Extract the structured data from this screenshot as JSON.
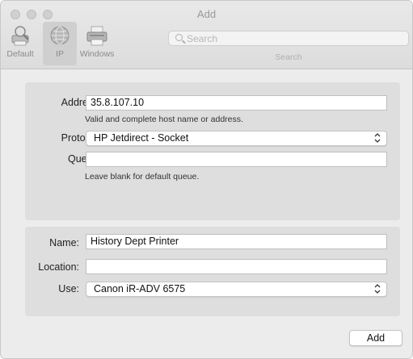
{
  "window": {
    "title": "Add"
  },
  "toolbar": {
    "default_label": "Default",
    "ip_label": "IP",
    "windows_label": "Windows",
    "search_label": "Search"
  },
  "search": {
    "placeholder": "Search"
  },
  "connection": {
    "address_label": "Address:",
    "address_value": "35.8.107.10",
    "address_hint": "Valid and complete host name or address.",
    "protocol_label": "Protocol:",
    "protocol_value": "HP Jetdirect - Socket",
    "queue_label": "Queue:",
    "queue_value": "",
    "queue_hint": "Leave blank for default queue."
  },
  "printer": {
    "name_label": "Name:",
    "name_value": "History Dept Printer",
    "location_label": "Location:",
    "location_value": "",
    "use_label": "Use:",
    "use_value": "Canon iR-ADV 6575"
  },
  "actions": {
    "add_label": "Add"
  },
  "icons": [
    "default-printer-icon",
    "ip-globe-icon",
    "windows-printer-icon",
    "search-icon",
    "chevron-updown-icon"
  ]
}
